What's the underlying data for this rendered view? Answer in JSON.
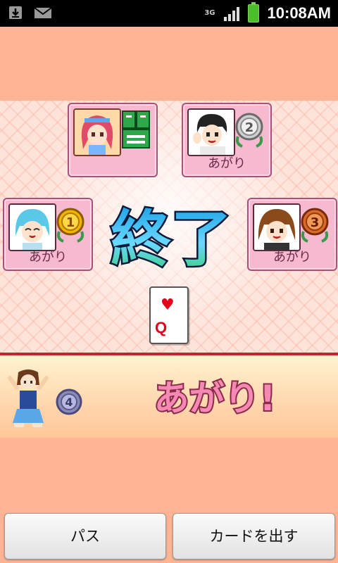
{
  "status_bar": {
    "time": "10:08AM",
    "network": "3G",
    "icons": [
      "download-icon",
      "mail-icon",
      "signal-icon",
      "battery-icon"
    ]
  },
  "game": {
    "end_title": "終了",
    "players": [
      {
        "position": "top-left",
        "status": "",
        "rank": null,
        "pass_mark": "パス"
      },
      {
        "position": "top-right",
        "status": "あがり",
        "rank": 2
      },
      {
        "position": "left",
        "status": "あがり",
        "rank": 1
      },
      {
        "position": "right",
        "status": "あがり",
        "rank": 3
      }
    ],
    "center_card": {
      "suit": "♥",
      "rank": "Q"
    },
    "self": {
      "rank": 4,
      "status": "あがり!"
    }
  },
  "buttons": {
    "pass_label": "パス",
    "play_label": "カードを出す"
  },
  "colors": {
    "background": "#ffb494",
    "panel": "#f6b9d0",
    "divider": "#c2252c",
    "status_text": "#f07aa8"
  }
}
